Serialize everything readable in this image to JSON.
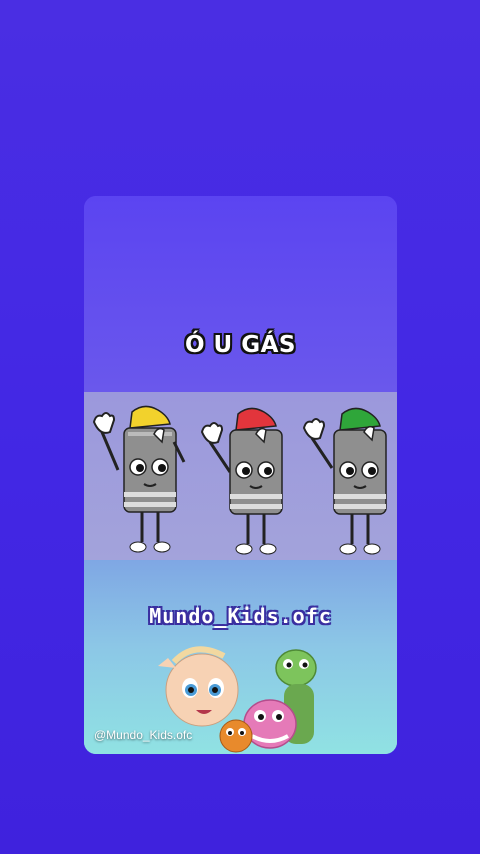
{
  "video": {
    "caption": "Ó U GÁS",
    "brand_title": "Mundo_Kids.ofc",
    "watermark_handle": "@Mundo_Kids.ofc"
  },
  "characters": [
    {
      "name": "gas-cylinder-yellow-cap",
      "cap_color": "#f2d22c"
    },
    {
      "name": "gas-cylinder-red-cap",
      "cap_color": "#e2353c"
    },
    {
      "name": "gas-cylinder-green-cap",
      "cap_color": "#2fa63a"
    }
  ],
  "colors": {
    "background": "#4227e4",
    "cylinder_body": "#8f8f8f",
    "text_outline": "#111111"
  }
}
